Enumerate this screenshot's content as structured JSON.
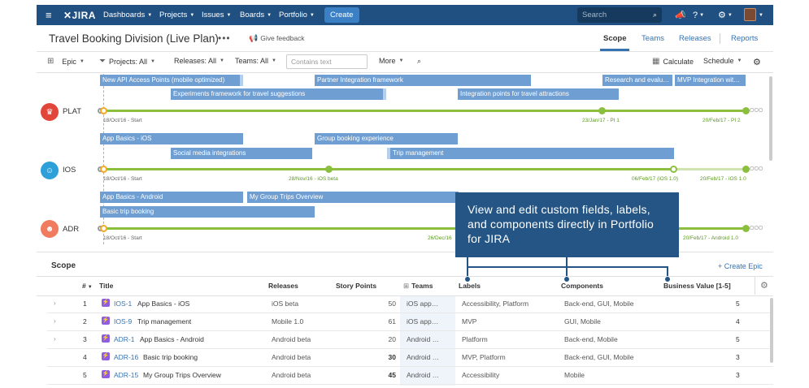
{
  "nav": {
    "menu_icon": "≡",
    "logo": "✕JIRA",
    "items": [
      "Dashboards",
      "Projects",
      "Issues",
      "Boards",
      "Portfolio"
    ],
    "create": "Create",
    "search_placeholder": "Search",
    "icons": [
      "megaphone-icon",
      "help-icon",
      "gear-icon",
      "avatar"
    ]
  },
  "header": {
    "title": "Travel Booking Division (Live Plan)",
    "more": "•••",
    "feedback": "Give feedback",
    "tabs": [
      "Scope",
      "Teams",
      "Releases",
      "Reports"
    ],
    "active_tab": "Scope"
  },
  "toolbar": {
    "epic": "Epic",
    "projects": "Projects: All",
    "releases": "Releases: All",
    "teams": "Teams: All",
    "text_placeholder": "Contains text",
    "more": "More",
    "calculate": "Calculate",
    "schedule": "Schedule"
  },
  "timeline": {
    "lanes": [
      {
        "name": "PLAT",
        "icon": "plat-project-icon",
        "color": "#e2463a",
        "bars": [
          "New API Access Points (mobile optimized)",
          "Partner Integration framework",
          "Research and evalu…",
          "MVP Integration wit…",
          "Experiments framework for travel suggestions",
          "Integration points for travel attractions"
        ],
        "releases": [
          "18/Oct/16 - Start",
          "23/Jan/17 - PI 1",
          "20/Feb/17 - PI 2"
        ]
      },
      {
        "name": "IOS",
        "icon": "ios-project-icon",
        "color": "#2d9fd9",
        "bars": [
          "App Basics - iOS",
          "Group booking experience",
          "Social media integrations",
          "Trip management"
        ],
        "releases": [
          "18/Oct/16 - Start",
          "28/Nov/16 - iOS beta",
          "06/Feb/17 (iOS 1.0)",
          "20/Feb/17 - iOS 1.0"
        ]
      },
      {
        "name": "ADR",
        "icon": "adr-project-icon",
        "color": "#f07b5f",
        "bars": [
          "App Basics - Android",
          "My Group Trips Overview",
          "Basic trip booking"
        ],
        "releases": [
          "18/Oct/16 - Start",
          "26/Dec/16",
          "20/Feb/17 - Android 1.0"
        ]
      }
    ],
    "end_marker": "OOO"
  },
  "callout": {
    "text": "View and edit custom fields, labels, and components directly in Portfolio for JIRA"
  },
  "scope": {
    "title": "Scope",
    "create_epic": "+ Create Epic",
    "columns": [
      "#",
      "Title",
      "Releases",
      "Story Points",
      "Teams",
      "Labels",
      "Components",
      "Business Value [1-5]"
    ],
    "rows": [
      {
        "expander": "›",
        "num": "1",
        "key": "IOS-1",
        "title": "App Basics - iOS",
        "release": "iOS beta",
        "points": "50",
        "team": "iOS app…",
        "labels": "Accessibility, Platform",
        "components": "Back-end, GUI, Mobile",
        "value": "5"
      },
      {
        "expander": "›",
        "num": "2",
        "key": "IOS-9",
        "title": "Trip management",
        "release": "Mobile 1.0",
        "points": "61",
        "team": "iOS app…",
        "labels": "MVP",
        "components": "GUI, Mobile",
        "value": "4"
      },
      {
        "expander": "›",
        "num": "3",
        "key": "ADR-1",
        "title": "App Basics - Android",
        "release": "Android beta",
        "points": "20",
        "team": "Android …",
        "labels": "Platform",
        "components": "Back-end, Mobile",
        "value": "5"
      },
      {
        "expander": "",
        "num": "4",
        "key": "ADR-16",
        "title": "Basic trip booking",
        "release": "Android beta",
        "points": "30",
        "team": "Android …",
        "labels": "MVP, Platform",
        "components": "Back-end, GUI, Mobile",
        "value": "3"
      },
      {
        "expander": "",
        "num": "5",
        "key": "ADR-15",
        "title": "My Group Trips Overview",
        "release": "Android beta",
        "points": "45",
        "team": "Android …",
        "labels": "Accessibility",
        "components": "Mobile",
        "value": "3"
      }
    ]
  },
  "colors": {
    "nav_bg": "#205081",
    "bar": "#6f9ed2",
    "release_line": "#8bbf3d",
    "callout": "#245584",
    "link": "#3572b0",
    "epic": "#8f5ee0"
  }
}
